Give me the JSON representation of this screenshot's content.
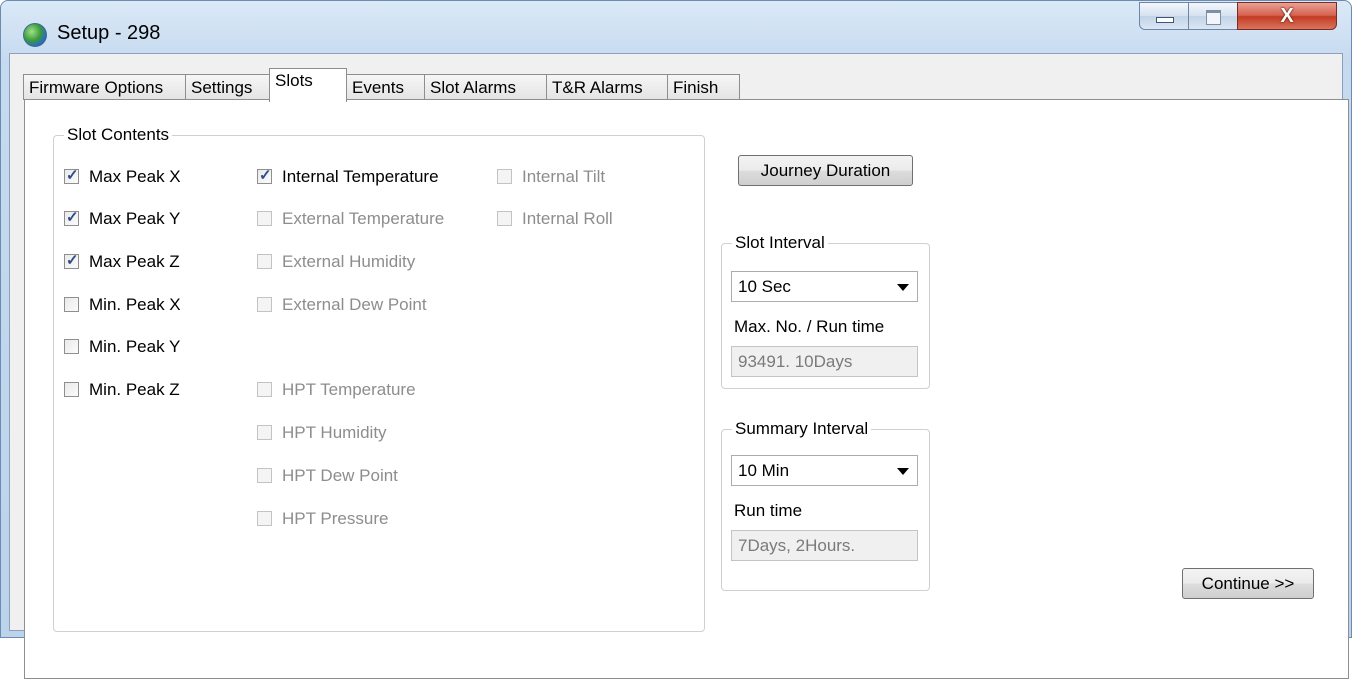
{
  "window": {
    "title": "Setup - 298",
    "close_glyph": "X"
  },
  "tabs": [
    {
      "label": "Firmware Options"
    },
    {
      "label": "Settings"
    },
    {
      "label": "Slots"
    },
    {
      "label": "Events"
    },
    {
      "label": "Slot Alarms"
    },
    {
      "label": "T&R Alarms"
    },
    {
      "label": "Finish"
    }
  ],
  "active_tab": "Slots",
  "slot_contents": {
    "title": "Slot Contents",
    "items": [
      {
        "label": "Max Peak X",
        "checked": true,
        "enabled": true
      },
      {
        "label": "Max Peak Y",
        "checked": true,
        "enabled": true
      },
      {
        "label": "Max Peak Z",
        "checked": true,
        "enabled": true
      },
      {
        "label": "Min. Peak X",
        "checked": false,
        "enabled": true
      },
      {
        "label": "Min. Peak Y",
        "checked": false,
        "enabled": true
      },
      {
        "label": "Min. Peak Z",
        "checked": false,
        "enabled": true
      },
      {
        "label": "Internal Temperature",
        "checked": true,
        "enabled": true
      },
      {
        "label": "External Temperature",
        "checked": false,
        "enabled": false
      },
      {
        "label": "External Humidity",
        "checked": false,
        "enabled": false
      },
      {
        "label": "External Dew Point",
        "checked": false,
        "enabled": false
      },
      {
        "label": "HPT Temperature",
        "checked": false,
        "enabled": false
      },
      {
        "label": "HPT Humidity",
        "checked": false,
        "enabled": false
      },
      {
        "label": "HPT Dew Point",
        "checked": false,
        "enabled": false
      },
      {
        "label": "HPT Pressure",
        "checked": false,
        "enabled": false
      },
      {
        "label": "Internal Tilt",
        "checked": false,
        "enabled": false
      },
      {
        "label": "Internal Roll",
        "checked": false,
        "enabled": false
      }
    ]
  },
  "journey_duration_label": "Journey Duration",
  "slot_interval": {
    "title": "Slot Interval",
    "selected": "10 Sec",
    "max_label": "Max. No. / Run time",
    "max_value": "93491.  10Days"
  },
  "summary_interval": {
    "title": "Summary Interval",
    "selected": "10 Min",
    "run_label": "Run time",
    "run_value": "7Days, 2Hours."
  },
  "continue_label": "Continue >>"
}
